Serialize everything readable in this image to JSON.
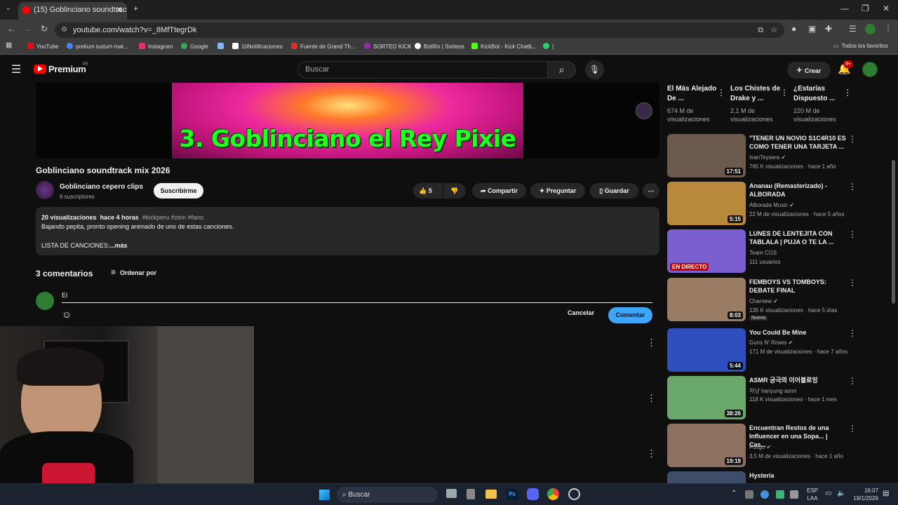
{
  "browser": {
    "tab_title": "(15) Goblinciano soundtrack mi",
    "url": "youtube.com/watch?v=_8MfTtegrDk",
    "bookmarks": [
      {
        "label": "YouTube",
        "color": "#ff0000"
      },
      {
        "label": "pretium iustum mat...",
        "color": "#4285f4"
      },
      {
        "label": "Instagram",
        "color": "#e1306c"
      },
      {
        "label": "Google",
        "color": "#34a853"
      },
      {
        "label": "",
        "color": "#8ab4f8"
      },
      {
        "label": "10Notificaciones",
        "color": "#ffffff"
      },
      {
        "label": "Fuente de Grand Th...",
        "color": "#d93025"
      },
      {
        "label": "SORTEO KICK",
        "color": "#9c27b0"
      },
      {
        "label": "BotRix | Sorteos",
        "color": "#ffffff"
      },
      {
        "label": "KickBot - Kick Chatb...",
        "color": "#53fc18"
      },
      {
        "label": "|",
        "color": "#25d366"
      }
    ],
    "all_favorites": "Todos los favoritos"
  },
  "header": {
    "logo": "Premium",
    "logo_region": "PE",
    "search_placeholder": "Buscar",
    "create_label": "Crear",
    "notif_badge": "9+"
  },
  "video": {
    "banner_text": "3. Goblinciano el Rey Pixie",
    "title": "Goblinciano soundtrack mix 2026",
    "channel": "Goblinciano cepero clips",
    "subscribers": "6 suscriptores",
    "subscribe_label": "Suscribirme",
    "likes": "5",
    "share_label": "Compartir",
    "ask_label": "Preguntar",
    "save_label": "Guardar",
    "description": {
      "views": "20 visualizaciones",
      "time": "hace 4 horas",
      "tags": "#kickperu #zein #fano",
      "line1": "Bajando pepita, pronto opening animado de uno de estas canciones.",
      "line2": "LISTA DE CANCIONES:",
      "more": "...más"
    }
  },
  "comments": {
    "count_label": "3 comentarios",
    "sort_label": "Ordenar por",
    "input_value": "El",
    "cancel_label": "Cancelar",
    "submit_label": "Comentar"
  },
  "recommendations_top": [
    {
      "title": "El Más Alejado De ...",
      "views": "674 M de",
      "views2": "visualizaciones"
    },
    {
      "title": "Los Chistes de Drake y ...",
      "views": "2,1 M de",
      "views2": "visualizaciones"
    },
    {
      "title": "¿Estarías Dispuesto ...",
      "views": "220 M de",
      "views2": "visualizaciones"
    }
  ],
  "recommendations": [
    {
      "title": "\"TENER UN NOVIO S1C4R10 ES COMO TENER UNA TARJETA ...",
      "channel": "IvanTeysera",
      "meta": "765 K visualizaciones · hace 1 año",
      "duration": "17:51",
      "badge": "",
      "thumb": "#6b5a4d"
    },
    {
      "title": "Ananau (Remasterizado) - ALBORADA",
      "channel": "Alborada Music",
      "meta": "22 M de visualizaciones · hace 5 años",
      "duration": "5:15",
      "badge": "",
      "thumb": "#b8893a"
    },
    {
      "title": "LUNES DE LENTEJITA CON TABLALA | PUJA O TE LA ...",
      "channel": "Team CGS",
      "meta": "111 usuarios",
      "duration": "",
      "badge": "EN DIRECTO",
      "thumb": "#7a5fd0"
    },
    {
      "title": "FEMBOYS VS TOMBOYS: DEBATE FINAL",
      "channel": "Charnew",
      "meta": "135 K visualizaciones · hace 5 días",
      "duration": "8:03",
      "badge": "Nuevo",
      "thumb": "#9a7b64"
    },
    {
      "title": "You Could Be Mine",
      "channel": "Guns N' Roses",
      "meta": "171 M de visualizaciones · hace 7 años",
      "duration": "5:44",
      "badge": "",
      "thumb": "#2f4fbf"
    },
    {
      "title": "ASMR 궁극의 이어블로잉",
      "channel": "하냥 hanyung asmr",
      "meta": "118 K visualizaciones · hace 1 mes",
      "duration": "38:26",
      "badge": "",
      "thumb": "#6aa86a"
    },
    {
      "title": "Encuentran Restos de una Influencer en una Sopa... | Cas...",
      "channel": "Fusgo",
      "meta": "3,5 M de visualizaciones · hace 1 año",
      "duration": "19:19",
      "badge": "",
      "thumb": "#8e7060"
    },
    {
      "title": "Hysteria",
      "channel": "",
      "meta": "",
      "duration": "",
      "badge": "",
      "thumb": "#3d4d6a"
    }
  ],
  "taskbar": {
    "search_placeholder": "Buscar",
    "lang1": "ESP",
    "lang2": "LAA",
    "time": "16:07",
    "date": "19/1/2026"
  }
}
